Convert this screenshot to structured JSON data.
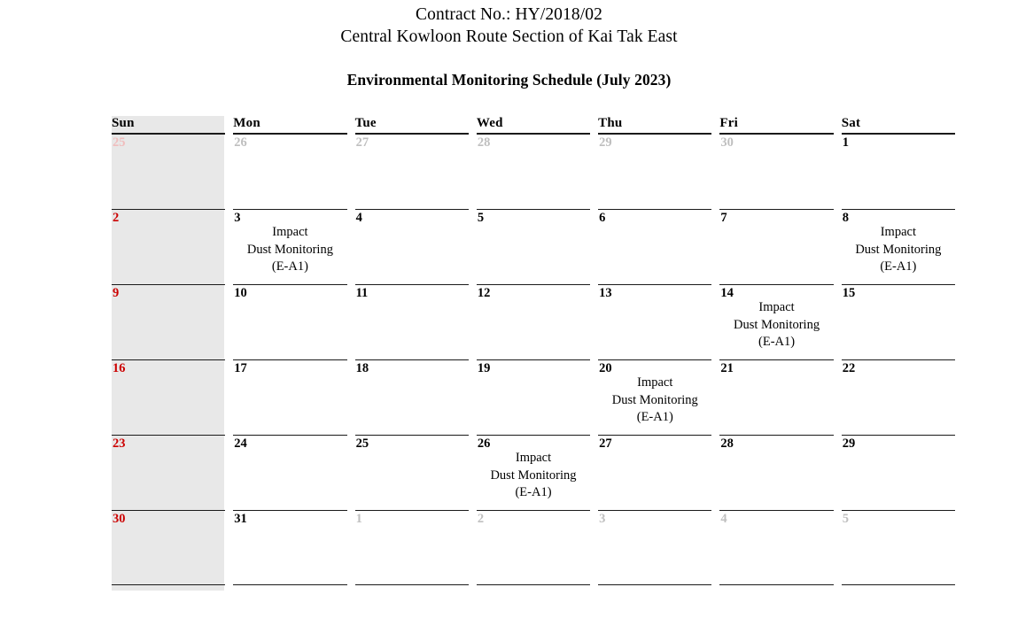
{
  "header": {
    "contract_line": "Contract No.: HY/2018/02",
    "project_line": "Central Kowloon Route Section of Kai Tak East",
    "schedule_title": "Environmental Monitoring Schedule (July 2023)"
  },
  "calendar": {
    "month_label": "July 2023",
    "daynames": [
      "Sun",
      "Mon",
      "Tue",
      "Wed",
      "Thu",
      "Fri",
      "Sat"
    ],
    "colors": {
      "sunday_text": "#cc0000",
      "sunday_column_background": "#e8e8e8",
      "other_month_text": "#bfbfbf",
      "grid_line": "#1a1a1a"
    },
    "event_label": "Impact\nDust Monitoring\n(E-A1)",
    "weeks": [
      [
        {
          "num": "25",
          "in_month": false,
          "event": ""
        },
        {
          "num": "26",
          "in_month": false,
          "event": ""
        },
        {
          "num": "27",
          "in_month": false,
          "event": ""
        },
        {
          "num": "28",
          "in_month": false,
          "event": ""
        },
        {
          "num": "29",
          "in_month": false,
          "event": ""
        },
        {
          "num": "30",
          "in_month": false,
          "event": ""
        },
        {
          "num": "1",
          "in_month": true,
          "event": ""
        }
      ],
      [
        {
          "num": "2",
          "in_month": true,
          "event": ""
        },
        {
          "num": "3",
          "in_month": true,
          "event": "Impact\nDust Monitoring\n(E-A1)"
        },
        {
          "num": "4",
          "in_month": true,
          "event": ""
        },
        {
          "num": "5",
          "in_month": true,
          "event": ""
        },
        {
          "num": "6",
          "in_month": true,
          "event": ""
        },
        {
          "num": "7",
          "in_month": true,
          "event": ""
        },
        {
          "num": "8",
          "in_month": true,
          "event": "Impact\nDust Monitoring\n(E-A1)"
        }
      ],
      [
        {
          "num": "9",
          "in_month": true,
          "event": ""
        },
        {
          "num": "10",
          "in_month": true,
          "event": ""
        },
        {
          "num": "11",
          "in_month": true,
          "event": ""
        },
        {
          "num": "12",
          "in_month": true,
          "event": ""
        },
        {
          "num": "13",
          "in_month": true,
          "event": ""
        },
        {
          "num": "14",
          "in_month": true,
          "event": "Impact\nDust Monitoring\n(E-A1)"
        },
        {
          "num": "15",
          "in_month": true,
          "event": ""
        }
      ],
      [
        {
          "num": "16",
          "in_month": true,
          "event": ""
        },
        {
          "num": "17",
          "in_month": true,
          "event": ""
        },
        {
          "num": "18",
          "in_month": true,
          "event": ""
        },
        {
          "num": "19",
          "in_month": true,
          "event": ""
        },
        {
          "num": "20",
          "in_month": true,
          "event": "Impact\nDust Monitoring\n(E-A1)"
        },
        {
          "num": "21",
          "in_month": true,
          "event": ""
        },
        {
          "num": "22",
          "in_month": true,
          "event": ""
        }
      ],
      [
        {
          "num": "23",
          "in_month": true,
          "event": ""
        },
        {
          "num": "24",
          "in_month": true,
          "event": ""
        },
        {
          "num": "25",
          "in_month": true,
          "event": ""
        },
        {
          "num": "26",
          "in_month": true,
          "event": "Impact\nDust Monitoring\n(E-A1)"
        },
        {
          "num": "27",
          "in_month": true,
          "event": ""
        },
        {
          "num": "28",
          "in_month": true,
          "event": ""
        },
        {
          "num": "29",
          "in_month": true,
          "event": ""
        }
      ],
      [
        {
          "num": "30",
          "in_month": true,
          "event": ""
        },
        {
          "num": "31",
          "in_month": true,
          "event": ""
        },
        {
          "num": "1",
          "in_month": false,
          "event": ""
        },
        {
          "num": "2",
          "in_month": false,
          "event": ""
        },
        {
          "num": "3",
          "in_month": false,
          "event": ""
        },
        {
          "num": "4",
          "in_month": false,
          "event": ""
        },
        {
          "num": "5",
          "in_month": false,
          "event": ""
        }
      ]
    ]
  }
}
